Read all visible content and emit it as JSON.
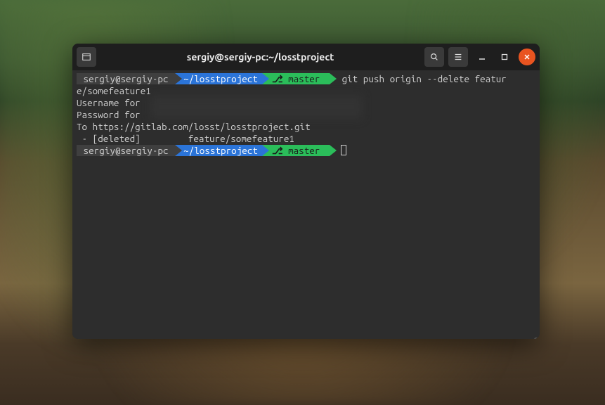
{
  "window": {
    "title": "sergiy@sergiy-pc:~/losstproject"
  },
  "prompt1": {
    "user_host": " sergiy@sergiy-pc ",
    "path": "~/losstproject",
    "branch_icon": "⎇",
    "branch": "master",
    "command": "git push origin --delete featur",
    "command_wrap": "e/somefeature1"
  },
  "output": {
    "line1_label": "Username for",
    "line2_label": "Password for",
    "line3": "To https://gitlab.com/losst/losstproject.git",
    "line4": " - [deleted]         feature/somefeature1"
  },
  "prompt2": {
    "user_host": " sergiy@sergiy-pc ",
    "path": "~/losstproject",
    "branch_icon": "⎇",
    "branch": "master"
  }
}
